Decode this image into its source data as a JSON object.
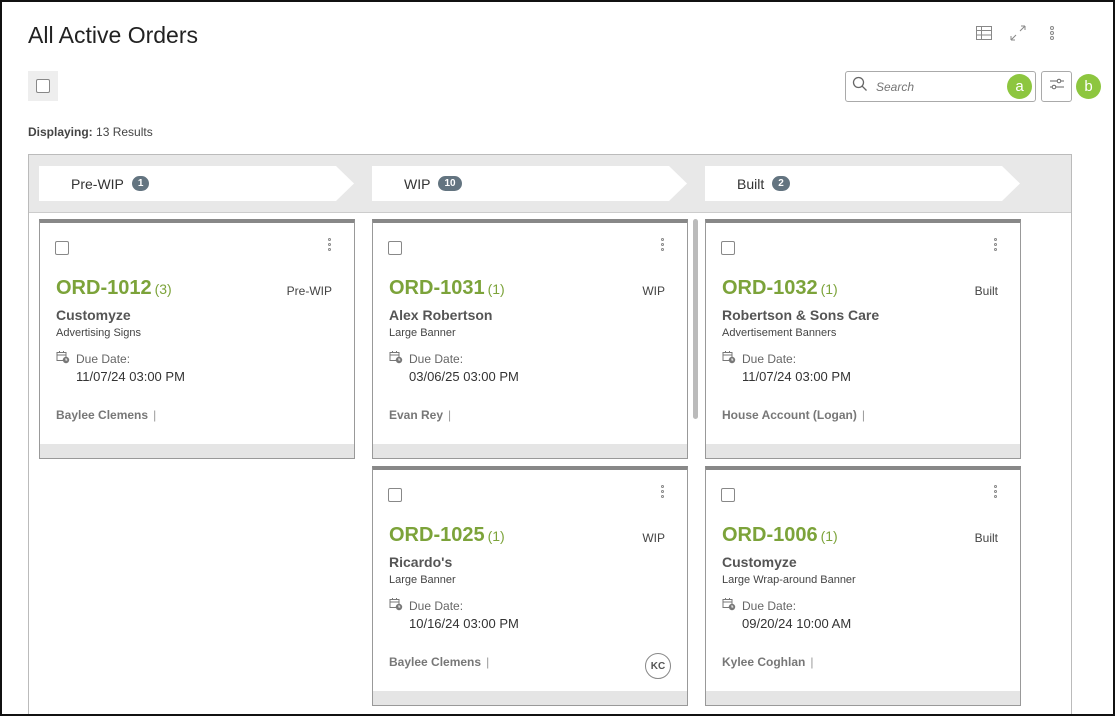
{
  "page": {
    "title": "All Active Orders",
    "displaying_label": "Displaying:",
    "displaying_value": "13 Results"
  },
  "toolbar": {
    "search_placeholder": "Search",
    "badge_a": "a",
    "badge_b": "b",
    "icons": [
      "table-view-icon",
      "expand-icon",
      "more-vertical-icon",
      "search-icon",
      "filter-sliders-icon"
    ]
  },
  "stages": [
    {
      "name": "Pre-WIP",
      "count": "1"
    },
    {
      "name": "WIP",
      "count": "10"
    },
    {
      "name": "Built",
      "count": "2"
    }
  ],
  "columns": {
    "prewip": [
      {
        "id": "ORD-1012",
        "qty": "(3)",
        "stage": "Pre-WIP",
        "customer": "Customyze",
        "product": "Advertising Signs",
        "due_label": "Due Date:",
        "due": "11/07/24 03:00 PM",
        "assignee": "Baylee Clemens",
        "sep": "|",
        "avatar": ""
      }
    ],
    "wip": [
      {
        "id": "ORD-1031",
        "qty": "(1)",
        "stage": "WIP",
        "customer": "Alex Robertson",
        "product": "Large Banner",
        "due_label": "Due Date:",
        "due": "03/06/25 03:00 PM",
        "assignee": "Evan Rey",
        "sep": "|",
        "avatar": ""
      },
      {
        "id": "ORD-1025",
        "qty": "(1)",
        "stage": "WIP",
        "customer": "Ricardo's",
        "product": "Large Banner",
        "due_label": "Due Date:",
        "due": "10/16/24 03:00 PM",
        "assignee": "Baylee Clemens",
        "sep": "|",
        "avatar": "KC"
      }
    ],
    "built": [
      {
        "id": "ORD-1032",
        "qty": "(1)",
        "stage": "Built",
        "customer": "Robertson & Sons Care",
        "product": "Advertisement Banners",
        "due_label": "Due Date:",
        "due": "11/07/24 03:00 PM",
        "assignee": "House Account (Logan)",
        "sep": "|",
        "avatar": ""
      },
      {
        "id": "ORD-1006",
        "qty": "(1)",
        "stage": "Built",
        "customer": "Customyze",
        "product": "Large Wrap-around Banner",
        "due_label": "Due Date:",
        "due": "09/20/24 10:00 AM",
        "assignee": "Kylee Coghlan",
        "sep": "|",
        "avatar": ""
      }
    ]
  },
  "colors": {
    "accent_green": "#8dc63f",
    "order_green": "#7ca33a",
    "stage_badge": "#637480"
  }
}
